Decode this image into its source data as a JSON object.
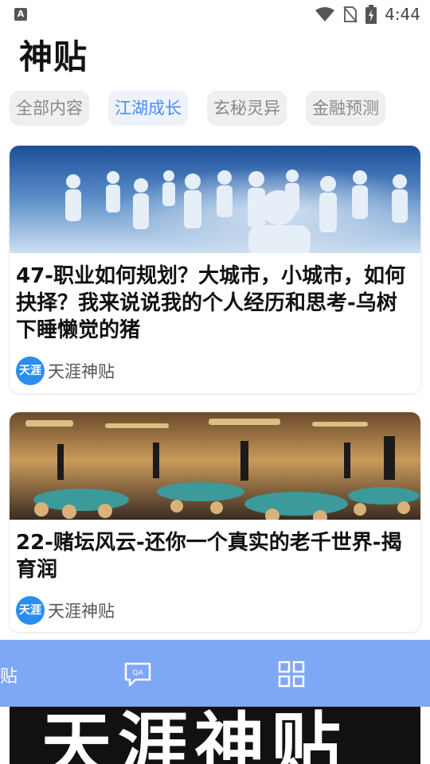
{
  "status_bar": {
    "time": "4:44",
    "app_badge": "A"
  },
  "page": {
    "title": "神贴"
  },
  "tabs": [
    {
      "label": "全部内容",
      "active": false
    },
    {
      "label": "江湖成长",
      "active": true
    },
    {
      "label": "玄秘灵异",
      "active": false
    },
    {
      "label": "金融预测",
      "active": false
    }
  ],
  "cards": [
    {
      "title": "47-职业如何规划？大城市，小城市，如何抉择？我来说说我的个人经历和思考-乌树下睡懒觉的猪",
      "source_logo": "天涯",
      "source_name": "天涯神贴"
    },
    {
      "title": "22-赌坛风云-还你一个真实的老千世界-揭育润",
      "source_logo": "天涯",
      "source_name": "天涯神贴"
    }
  ],
  "bottom_nav": {
    "label": "贴"
  },
  "banner": {
    "text": "天涯神贴"
  },
  "colors": {
    "accent": "#4d8cf5",
    "nav_bg": "#7ea7f5",
    "tab_bg": "#efefef",
    "source_logo_bg": "#2a8df0"
  },
  "icons": [
    "wifi-icon",
    "no-sim-icon",
    "battery-icon",
    "qa-chat-icon",
    "grid-icon"
  ]
}
